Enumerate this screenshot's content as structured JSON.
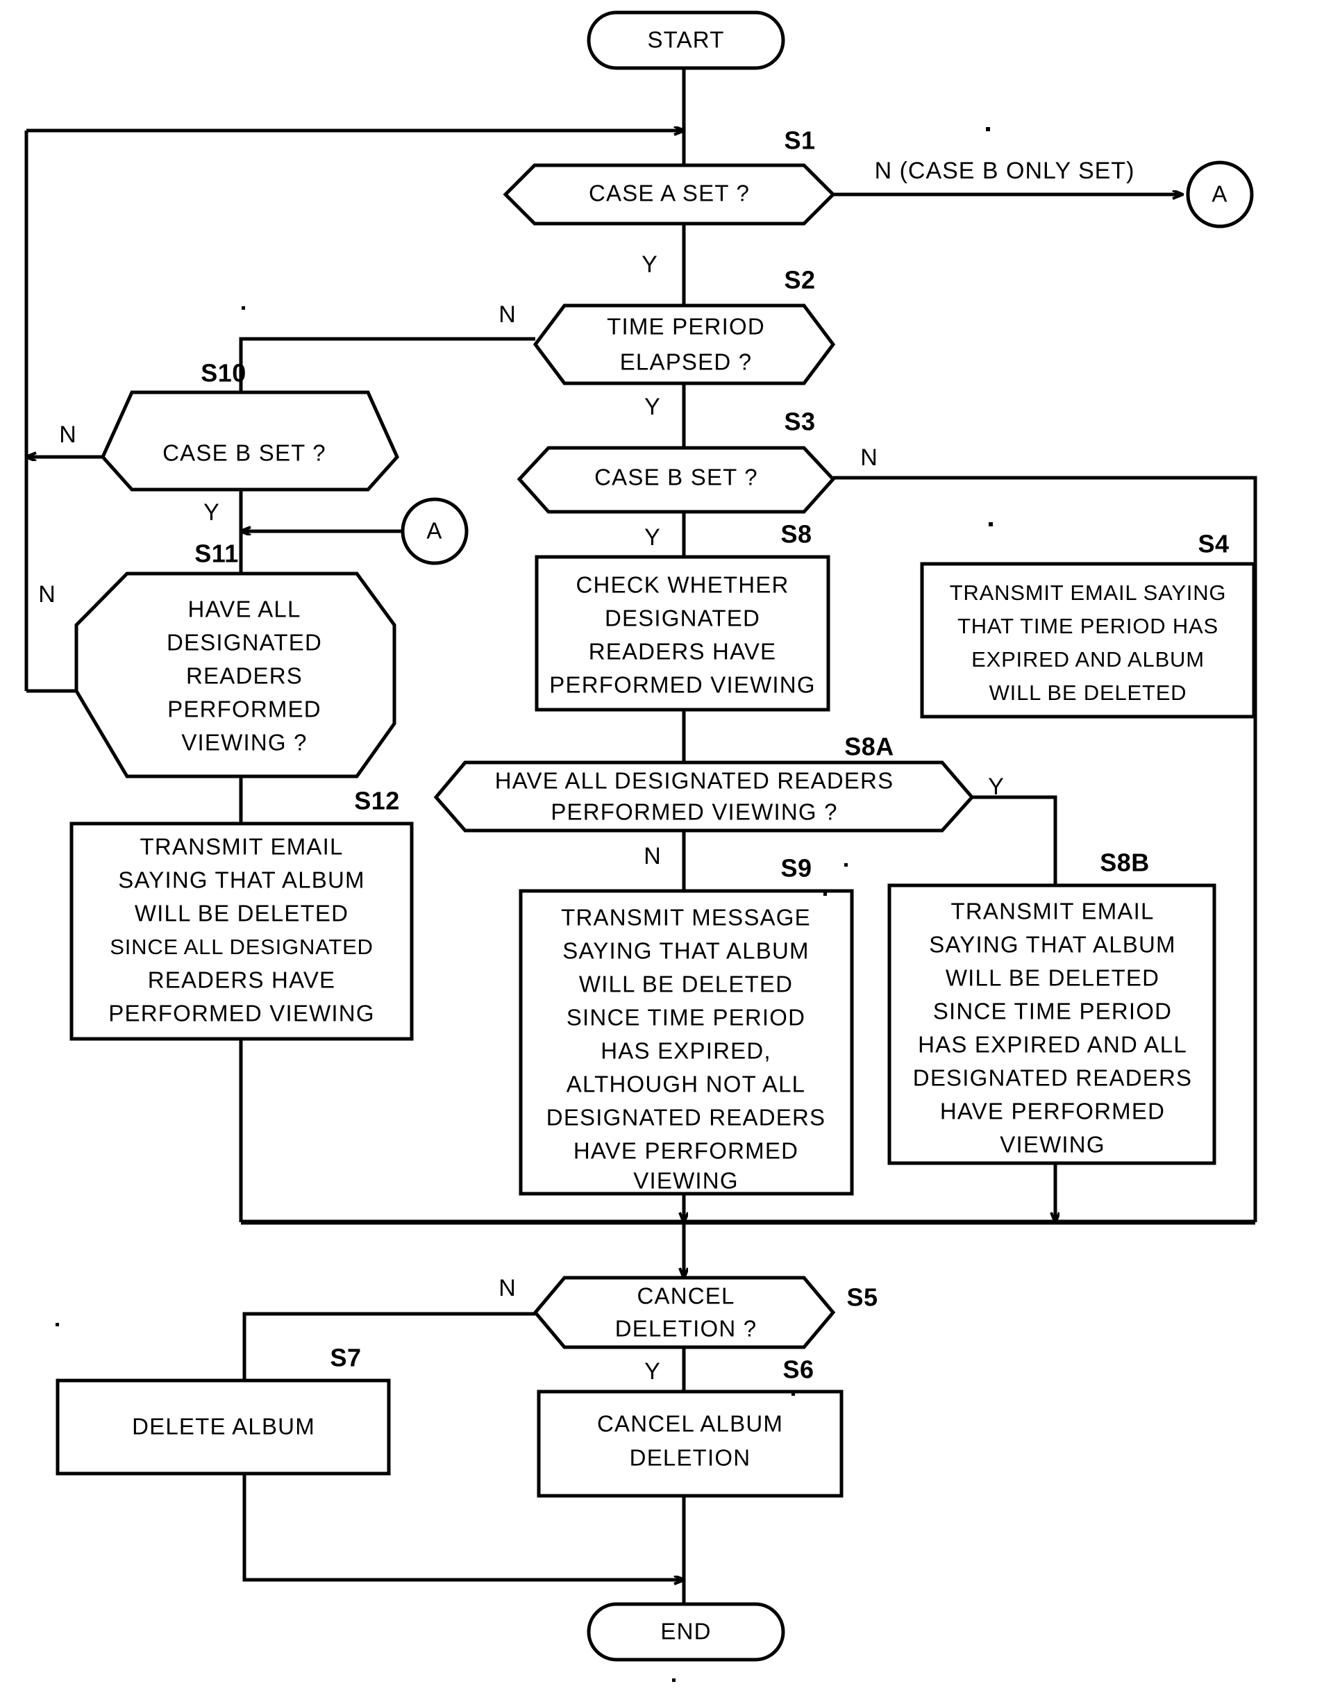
{
  "diagram": {
    "type": "flowchart",
    "title": "",
    "nodes": {
      "start": {
        "id": "start",
        "shape": "terminator",
        "text": "START"
      },
      "s1": {
        "id": "S1",
        "shape": "decision",
        "text": "CASE A SET ?",
        "step": "S1"
      },
      "s2": {
        "id": "S2",
        "shape": "decision",
        "line1": "TIME PERIOD",
        "line2": "ELAPSED ?",
        "step": "S2"
      },
      "s3": {
        "id": "S3",
        "shape": "decision",
        "text": "CASE B SET ?",
        "step": "S3"
      },
      "s10": {
        "id": "S10",
        "shape": "decision",
        "text": "CASE B SET ?",
        "step": "S10"
      },
      "s11": {
        "id": "S11",
        "shape": "decision",
        "step": "S11",
        "lines": [
          "HAVE ALL",
          "DESIGNATED",
          "READERS",
          "PERFORMED",
          "VIEWING ?"
        ]
      },
      "s12": {
        "id": "S12",
        "shape": "process",
        "step": "S12",
        "lines": [
          "TRANSMIT EMAIL",
          "SAYING THAT ALBUM",
          "WILL BE DELETED",
          "SINCE ALL DESIGNATED",
          "READERS HAVE",
          "PERFORMED VIEWING"
        ]
      },
      "s8": {
        "id": "S8",
        "shape": "process",
        "step": "S8",
        "lines": [
          "CHECK WHETHER",
          "DESIGNATED",
          "READERS HAVE",
          "PERFORMED VIEWING"
        ]
      },
      "s4": {
        "id": "S4",
        "shape": "process",
        "step": "S4",
        "lines": [
          "TRANSMIT EMAIL SAYING",
          "THAT TIME PERIOD HAS",
          "EXPIRED AND ALBUM",
          "WILL BE DELETED"
        ]
      },
      "s8a": {
        "id": "S8A",
        "shape": "decision",
        "step": "S8A",
        "lines": [
          "HAVE ALL DESIGNATED READERS",
          "PERFORMED VIEWING ?"
        ]
      },
      "s9": {
        "id": "S9",
        "shape": "process",
        "step": "S9",
        "lines": [
          "TRANSMIT MESSAGE",
          "SAYING THAT ALBUM",
          "WILL BE DELETED",
          "SINCE TIME PERIOD",
          "HAS EXPIRED,",
          "ALTHOUGH NOT ALL",
          "DESIGNATED READERS",
          "HAVE PERFORMED",
          "VIEWING"
        ]
      },
      "s8b": {
        "id": "S8B",
        "shape": "process",
        "step": "S8B",
        "lines": [
          "TRANSMIT EMAIL",
          "SAYING THAT ALBUM",
          "WILL BE DELETED",
          "SINCE TIME PERIOD",
          "HAS EXPIRED AND ALL",
          "DESIGNATED READERS",
          "HAVE PERFORMED",
          "VIEWING"
        ]
      },
      "s5": {
        "id": "S5",
        "shape": "decision",
        "line1": "CANCEL",
        "line2": "DELETION ?",
        "step": "S5"
      },
      "s7": {
        "id": "S7",
        "shape": "process",
        "text": "DELETE ALBUM",
        "step": "S7"
      },
      "s6": {
        "id": "S6",
        "shape": "process",
        "line1": "CANCEL ALBUM",
        "line2": "DELETION",
        "step": "S6"
      },
      "end": {
        "id": "end",
        "shape": "terminator",
        "text": "END"
      },
      "connector_a_right": {
        "id": "A",
        "shape": "offpage-connector",
        "text": "A"
      },
      "connector_a_left": {
        "id": "A",
        "shape": "offpage-connector",
        "text": "A"
      }
    },
    "edge_labels": {
      "s1_no": "N (CASE B ONLY SET)",
      "s1_yes": "Y",
      "s2_no": "N",
      "s2_yes": "Y",
      "s3_no": "N",
      "s3_yes": "Y",
      "s10_no": "N",
      "s10_yes": "Y",
      "s11_no": "N",
      "s8a_yes": "Y",
      "s8a_no": "N",
      "s5_no": "N",
      "s5_yes": "Y"
    },
    "colors": {
      "stroke": "#000000",
      "fill": "#ffffff",
      "background": "#ffffff"
    }
  }
}
